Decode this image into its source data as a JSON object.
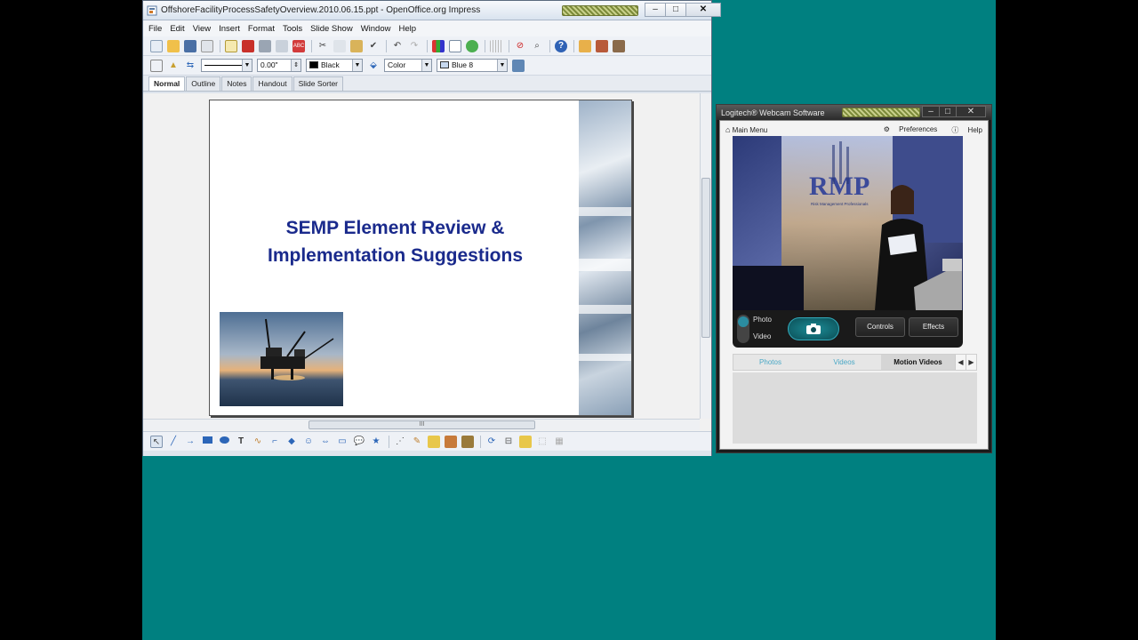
{
  "impress": {
    "title": "OffshoreFacilityProcessSafetyOverview.2010.06.15.ppt - OpenOffice.org Impress",
    "menu": [
      "File",
      "Edit",
      "View",
      "Insert",
      "Format",
      "Tools",
      "Slide Show",
      "Window",
      "Help"
    ],
    "line_width": "0.00\"",
    "line_color": "Black",
    "area_style": "Color",
    "area_color": "Blue 8",
    "view_tabs": [
      "Normal",
      "Outline",
      "Notes",
      "Handout",
      "Slide Sorter"
    ],
    "slide": {
      "title_line1": "SEMP Element Review &",
      "title_line2": "Implementation Suggestions"
    },
    "hscroll_mark": "III"
  },
  "webcam": {
    "title": "Logitech® Webcam Software",
    "main_menu": "Main Menu",
    "preferences": "Preferences",
    "help": "Help",
    "photo_label": "Photo",
    "video_label": "Video",
    "controls": "Controls",
    "effects": "Effects",
    "tabs": [
      "Photos",
      "Videos",
      "Motion Videos"
    ],
    "logo_text": "RMP",
    "logo_tagline": "Risk Management Professionals"
  },
  "colors": {
    "desktop": "#008080",
    "slide_title": "#1a2a8c",
    "accent_teal": "#2b8ca0"
  }
}
